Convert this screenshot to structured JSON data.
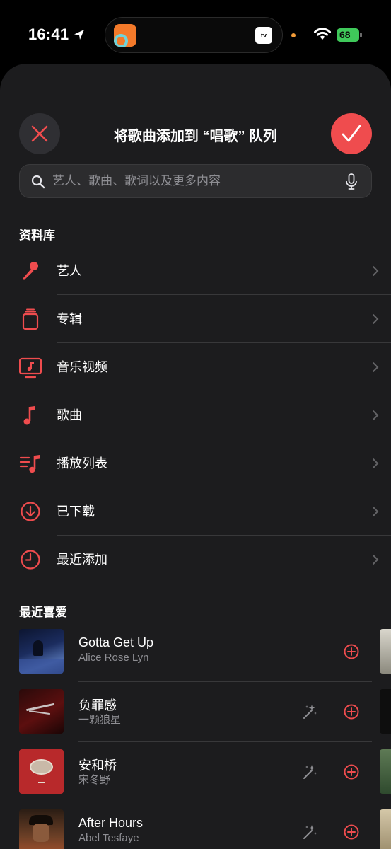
{
  "status_bar": {
    "time": "16:41",
    "battery": "68"
  },
  "sheet": {
    "title": "将歌曲添加到 “唱歌” 队列",
    "search_placeholder": "艺人、歌曲、歌词以及更多内容"
  },
  "library": {
    "title": "资料库",
    "items": [
      {
        "label": "艺人",
        "icon": "microphone-icon"
      },
      {
        "label": "专辑",
        "icon": "album-icon"
      },
      {
        "label": "音乐视频",
        "icon": "music-video-icon"
      },
      {
        "label": "歌曲",
        "icon": "music-note-icon"
      },
      {
        "label": "播放列表",
        "icon": "playlist-icon"
      },
      {
        "label": "已下载",
        "icon": "download-icon"
      },
      {
        "label": "最近添加",
        "icon": "clock-icon"
      }
    ]
  },
  "favorites": {
    "title": "最近喜爱",
    "songs": [
      {
        "title": "Gotta Get Up",
        "artist": "Alice Rose Lyn"
      },
      {
        "title": "负罪感",
        "artist": "一颗狼星"
      },
      {
        "title": "安和桥",
        "artist": "宋冬野"
      },
      {
        "title": "After Hours",
        "artist": "Abel Tesfaye"
      }
    ]
  },
  "colors": {
    "accent": "#ef4c4e",
    "background": "#1c1c1e",
    "divider": "#38383a"
  }
}
